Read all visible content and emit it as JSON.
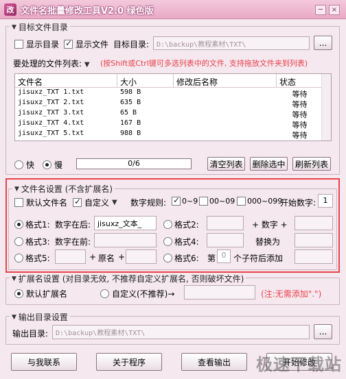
{
  "window": {
    "title": "文件名批量修改工具V2.0  绿色版",
    "app_icon_glyph": "改",
    "buttons": {
      "minimize": "─",
      "close": "×"
    }
  },
  "target_group": {
    "title": "目标文件目录",
    "show_dirs_label": "显示目录",
    "show_dirs_checked": false,
    "show_files_label": "显示文件",
    "show_files_checked": true,
    "target_dir_label": "目标目录:",
    "target_dir_value": "D:\\backup\\教程素材\\TXT\\",
    "browse_label": "...",
    "file_list_label": "要处理的文件列表:",
    "hint": "(按Shift或Ctrl键可多选列表中的文件, 支持拖放文件夹到列表)",
    "columns": [
      "文件名",
      "大小",
      "修改后名称",
      "状态"
    ],
    "rows": [
      {
        "name": "jisuxz_TXT 1.txt",
        "size": "598 B",
        "new_name": "",
        "status": "等待"
      },
      {
        "name": "jisuxz_TXT 2.txt",
        "size": "635 B",
        "new_name": "",
        "status": "等待"
      },
      {
        "name": "jisuxz_TXT 3.txt",
        "size": "65 B",
        "new_name": "",
        "status": "等待"
      },
      {
        "name": "jisuxz_TXT 4.txt",
        "size": "167 B",
        "new_name": "",
        "status": "等待"
      },
      {
        "name": "jisuxz_TXT 5.txt",
        "size": "988 B",
        "new_name": "",
        "status": "等待"
      }
    ],
    "speed_fast_label": "快",
    "speed_slow_label": "慢",
    "speed_selected": "慢",
    "progress_text": "0/6",
    "progress_fraction": 0,
    "clear_list_label": "清空列表",
    "delete_selected_label": "删除选中",
    "refresh_list_label": "刷新列表"
  },
  "filename_group": {
    "title": "文件名设置 (不含扩展名)",
    "default_name_label": "默认文件名",
    "default_name_checked": false,
    "custom_label": "自定义",
    "custom_checked": true,
    "rule_label": "数字规则:",
    "rule_a_label": "0~9",
    "rule_a_checked": true,
    "rule_b_label": "00~09",
    "rule_b_checked": false,
    "rule_c_label": "000~099",
    "rule_c_checked": false,
    "start_number_label": "开始数字:",
    "start_number_value": "1",
    "format1_label": "格式1:",
    "format1_suffix_label": "数字在后:",
    "format1_value": "jisuxz_文本_",
    "format2_label": "格式2:",
    "format2_plus_label": "+ 数字 +",
    "format3_label": "格式3:",
    "format3_prefix_label": "数字在前:",
    "format4_label": "格式4:",
    "format4_replace_label": "替换为",
    "format5_label": "格式5:",
    "format5_plus1": "+",
    "format5_orig": "原名",
    "format5_plus2": "+",
    "format6_label": "格式6:",
    "format6_nth": "第",
    "format6_value": "0",
    "format6_after": "个子符后添加",
    "selected_format": "格式1"
  },
  "ext_group": {
    "title": "扩展名设置 (对目录无效, 不推荐自定义扩展名, 否则破坏文件)",
    "default_ext_label": "默认扩展名",
    "custom_ext_label": "自定义(不推荐)→",
    "selected": "默认扩展名",
    "note": "(注:无需添加\".\")"
  },
  "output_group": {
    "title": "输出目录设置",
    "output_dir_label": "输出目录:",
    "output_dir_value": "D:\\backup\\教程素材\\TXT\\",
    "browse_label": "..."
  },
  "footer": {
    "contact_label": "与我联系",
    "about_label": "关于程序",
    "view_output_label": "查看输出",
    "start_label": "开始修改"
  },
  "watermark": "极速下载站",
  "colors": {
    "accent_red": "#e8424a",
    "titlebar": "#e9aac6",
    "background": "#f5e8ef"
  }
}
